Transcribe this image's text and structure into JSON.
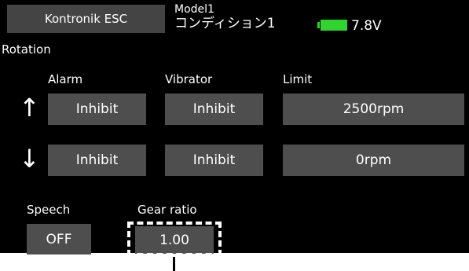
{
  "header": {
    "title": "Kontronik ESC",
    "model": "Model1",
    "condition": "コンディション1",
    "battery_level": 1.0,
    "voltage": "7.8V"
  },
  "section_title": "Rotation",
  "columns": {
    "alarm": "Alarm",
    "vibrator": "Vibrator",
    "limit": "Limit"
  },
  "rows": [
    {
      "arrow": "↑",
      "alarm": "Inhibit",
      "vibrator": "Inhibit",
      "limit": "2500rpm"
    },
    {
      "arrow": "↓",
      "alarm": "Inhibit",
      "vibrator": "Inhibit",
      "limit": "0rpm"
    }
  ],
  "speech": {
    "label": "Speech",
    "value": "OFF"
  },
  "gear_ratio": {
    "label": "Gear ratio",
    "value": "1.00"
  },
  "colors": {
    "screen_bg": "#000000",
    "button_bg": "#4e4e4e",
    "battery": "#2fd42f"
  }
}
